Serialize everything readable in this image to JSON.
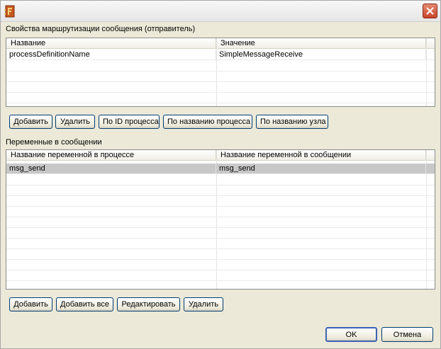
{
  "window": {
    "close_tooltip": "Close"
  },
  "routing": {
    "section_label": "Свойства маршрутизации сообщения (отправитель)",
    "columns": [
      "Название",
      "Значение"
    ],
    "rows": [
      [
        "processDefinitionName",
        "SimpleMessageReceive"
      ]
    ],
    "buttons": {
      "add": "Добавить",
      "delete": "Удалить",
      "by_process_id": "По ID процесса",
      "by_process_name": "По названию процесса",
      "by_node_name": "По названию узла"
    }
  },
  "variables": {
    "section_label": "Переменные в сообщении",
    "columns": [
      "Название переменной в процессе",
      "Название переменной в сообщении"
    ],
    "rows": [
      [
        "msg_send",
        "msg_send"
      ]
    ],
    "buttons": {
      "add": "Добавить",
      "add_all": "Добавить все",
      "edit": "Редактировать",
      "delete": "Удалить"
    }
  },
  "footer": {
    "ok": "OK",
    "cancel": "Отмена"
  },
  "colors": {
    "window_bg": "#ece9d8",
    "selected_row": "#c8c8c8",
    "close_button": "#c8452a"
  }
}
